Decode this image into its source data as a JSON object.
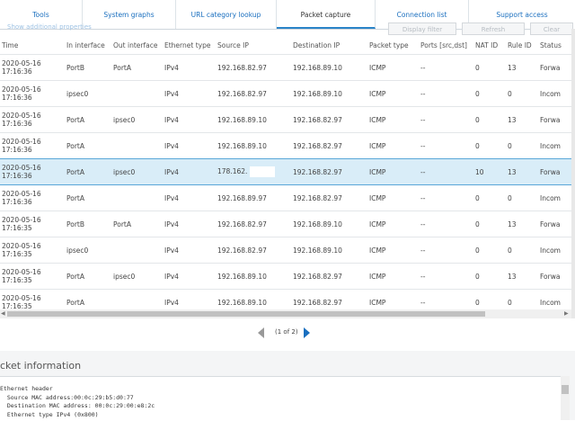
{
  "tabs": [
    "Tools",
    "System graphs",
    "URL category lookup",
    "Packet capture",
    "Connection list",
    "Support access"
  ],
  "toolbar": {
    "show_props": "Show additional properties",
    "display_filter": "Display filter",
    "refresh": "Refresh",
    "clear": "Clear"
  },
  "columns": [
    "Time",
    "In interface",
    "Out interface",
    "Ethernet type",
    "Source IP",
    "Destination IP",
    "Packet type",
    "Ports [src,dst]",
    "NAT ID",
    "Rule ID",
    "Status"
  ],
  "rows": [
    {
      "date": "2020-05-16",
      "time": "17:16:36",
      "in": "PortB",
      "out": "PortA",
      "eth": "IPv4",
      "src": "192.168.82.97",
      "dst": "192.168.89.10",
      "type": "ICMP",
      "ports": "--",
      "nat": "0",
      "rule": "13",
      "status": "Forwa"
    },
    {
      "date": "2020-05-16",
      "time": "17:16:36",
      "in": "ipsec0",
      "out": "",
      "eth": "IPv4",
      "src": "192.168.82.97",
      "dst": "192.168.89.10",
      "type": "ICMP",
      "ports": "--",
      "nat": "0",
      "rule": "0",
      "status": "Incom"
    },
    {
      "date": "2020-05-16",
      "time": "17:16:36",
      "in": "PortA",
      "out": "ipsec0",
      "eth": "IPv4",
      "src": "192.168.89.10",
      "dst": "192.168.82.97",
      "type": "ICMP",
      "ports": "--",
      "nat": "0",
      "rule": "13",
      "status": "Forwa"
    },
    {
      "date": "2020-05-16",
      "time": "17:16:36",
      "in": "PortA",
      "out": "",
      "eth": "IPv4",
      "src": "192.168.89.10",
      "dst": "192.168.82.97",
      "type": "ICMP",
      "ports": "--",
      "nat": "0",
      "rule": "0",
      "status": "Incom"
    },
    {
      "date": "2020-05-16",
      "time": "17:16:36",
      "in": "PortA",
      "out": "ipsec0",
      "eth": "IPv4",
      "src": "178.162.",
      "dst": "192.168.82.97",
      "type": "ICMP",
      "ports": "--",
      "nat": "10",
      "rule": "13",
      "status": "Forwa"
    },
    {
      "date": "2020-05-16",
      "time": "17:16:36",
      "in": "PortA",
      "out": "",
      "eth": "IPv4",
      "src": "192.168.89.97",
      "dst": "192.168.82.97",
      "type": "ICMP",
      "ports": "--",
      "nat": "0",
      "rule": "0",
      "status": "Incom"
    },
    {
      "date": "2020-05-16",
      "time": "17:16:35",
      "in": "PortB",
      "out": "PortA",
      "eth": "IPv4",
      "src": "192.168.82.97",
      "dst": "192.168.89.10",
      "type": "ICMP",
      "ports": "--",
      "nat": "0",
      "rule": "13",
      "status": "Forwa"
    },
    {
      "date": "2020-05-16",
      "time": "17:16:35",
      "in": "ipsec0",
      "out": "",
      "eth": "IPv4",
      "src": "192.168.82.97",
      "dst": "192.168.89.10",
      "type": "ICMP",
      "ports": "--",
      "nat": "0",
      "rule": "0",
      "status": "Incom"
    },
    {
      "date": "2020-05-16",
      "time": "17:16:35",
      "in": "PortA",
      "out": "ipsec0",
      "eth": "IPv4",
      "src": "192.168.89.10",
      "dst": "192.168.82.97",
      "type": "ICMP",
      "ports": "--",
      "nat": "0",
      "rule": "13",
      "status": "Forwa"
    },
    {
      "date": "2020-05-16",
      "time": "17:16:35",
      "in": "PortA",
      "out": "",
      "eth": "IPv4",
      "src": "192.168.89.10",
      "dst": "192.168.82.97",
      "type": "ICMP",
      "ports": "--",
      "nat": "0",
      "rule": "0",
      "status": "Incom"
    }
  ],
  "pager": {
    "label": "(1 of 2)"
  },
  "packet_info": {
    "title": "cket information",
    "text": "Ethernet header\n  Source MAC address:00:0c:29:b5:d0:77\n  Destination MAC address: 00:0c:29:00:e8:2c\n  Ethernet type IPv4 (0x800)"
  }
}
